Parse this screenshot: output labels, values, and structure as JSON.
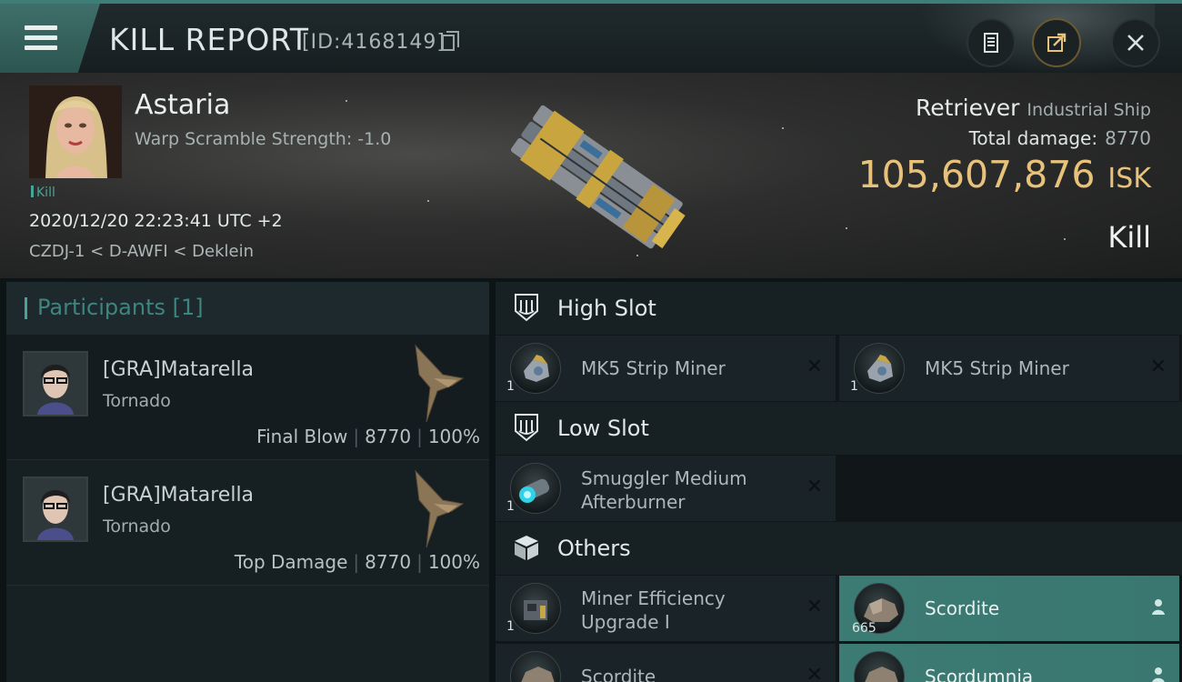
{
  "titlebar": {
    "title": "KILL REPORT",
    "id_text": "[ID:4168149]",
    "icons": [
      "menu-icon",
      "copy-icon",
      "report-icon",
      "share-icon",
      "close-icon"
    ]
  },
  "victim": {
    "pilot_name": "Astaria",
    "warp_scramble": "Warp Scramble Strength: -1.0",
    "tag": "Kill",
    "datetime": "2020/12/20 22:23:41 UTC +2",
    "location": "CZDJ-1 < D-AWFI < Deklein",
    "ship_name": "Retriever",
    "ship_class": "Industrial Ship",
    "total_damage_label": "Total damage:",
    "total_damage_value": "8770",
    "isk_value": "105,607,876",
    "isk_unit": "ISK",
    "result": "Kill"
  },
  "participants": {
    "header": "Participants [1]",
    "rows": [
      {
        "name": "[GRA]Matarella",
        "ship": "Tornado",
        "role": "Final Blow",
        "damage": "8770",
        "percent": "100%"
      },
      {
        "name": "[GRA]Matarella",
        "ship": "Tornado",
        "role": "Top Damage",
        "damage": "8770",
        "percent": "100%"
      }
    ]
  },
  "slots": {
    "high": {
      "label": "High Slot",
      "items": [
        {
          "name": "MK5 Strip Miner",
          "qty": "1"
        },
        {
          "name": "MK5 Strip Miner",
          "qty": "1"
        }
      ]
    },
    "low": {
      "label": "Low Slot",
      "items": [
        {
          "name_line1": "Smuggler Medium",
          "name_line2": "Afterburner",
          "qty": "1"
        }
      ]
    },
    "others": {
      "label": "Others",
      "items": [
        {
          "name_line1": "Miner Efficiency",
          "name_line2": "Upgrade I",
          "qty": "1"
        },
        {
          "name": "Scordite",
          "qty": "665"
        },
        {
          "name": "Scordite"
        },
        {
          "name": "Scordumnia"
        }
      ]
    }
  },
  "colors": {
    "accent": "#4aa39a",
    "isk": "#e8c27a",
    "highlight": "#3c7a74"
  }
}
